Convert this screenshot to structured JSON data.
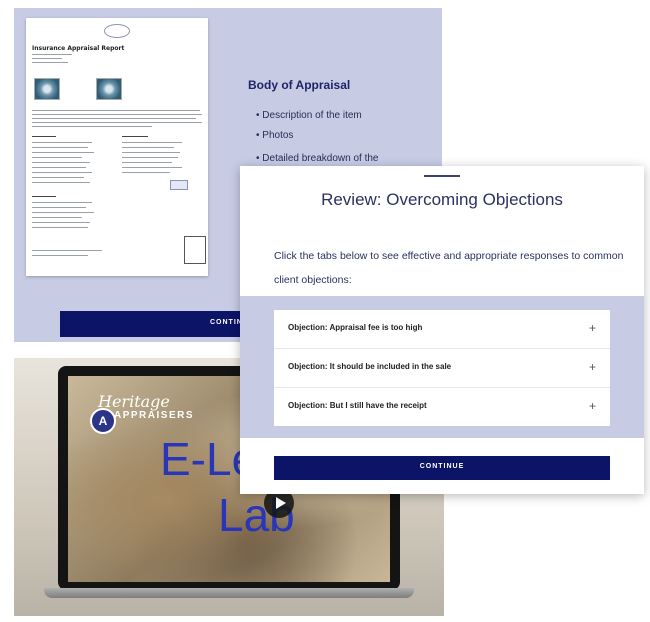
{
  "back_slide": {
    "report_title": "Insurance Appraisal Report",
    "body_title": "Body of Appraisal",
    "bullets": [
      "• Description of the item",
      "• Photos",
      "• Detailed breakdown of the"
    ],
    "continue_label": "CONTINUE"
  },
  "video": {
    "brand_top": "Heritage",
    "brand_bottom": "APPRAISERS",
    "line1": "E-Lea",
    "line2": "Lab"
  },
  "card": {
    "title": "Review: Overcoming Objections",
    "instructions": "Click the tabs below to see effective and appropriate responses to common client objections:",
    "tabs": [
      {
        "label": "Objection: Appraisal fee is too high",
        "icon": "+"
      },
      {
        "label": "Objection: It should be included in the sale",
        "icon": "+"
      },
      {
        "label": "Objection: But I still have the receipt",
        "icon": "+"
      }
    ],
    "continue_label": "CONTINUE"
  },
  "colors": {
    "panel": "#c7cbe4",
    "navy": "#0c1467",
    "title_blue": "#1f2466",
    "brand_blue": "#2a36b8"
  }
}
